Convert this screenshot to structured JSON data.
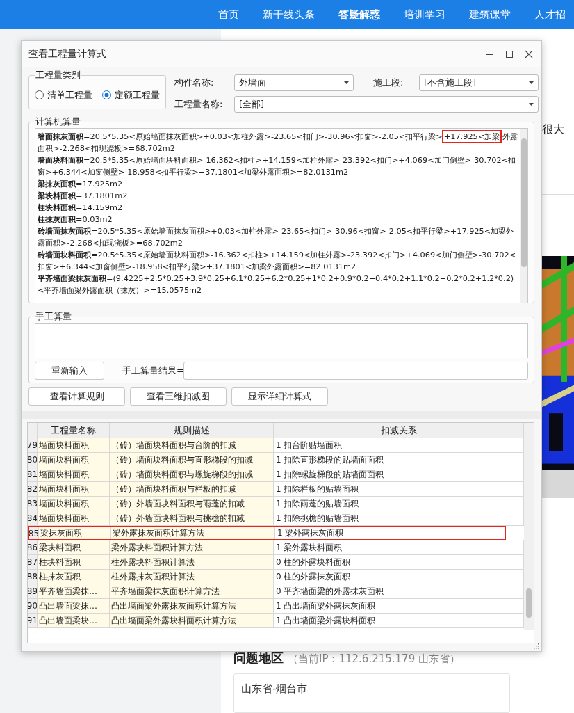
{
  "nav": {
    "items": [
      {
        "label": "首页",
        "selected": false
      },
      {
        "label": "新干线头条",
        "selected": false
      },
      {
        "label": "答疑解惑",
        "selected": true
      },
      {
        "label": "培训学习",
        "selected": false
      },
      {
        "label": "建筑课堂",
        "selected": false
      },
      {
        "label": "人才招",
        "selected": false
      }
    ]
  },
  "page": {
    "snippet": "很大",
    "region": {
      "title": "问题地区",
      "ip_note": "（当前IP：112.6.215.179 山东省）",
      "value": "山东省-烟台市"
    }
  },
  "dialog": {
    "title": "查看工程量计算式",
    "quantity_type": {
      "legend": "工程量类别",
      "options": [
        {
          "label": "清单工程量",
          "selected": false
        },
        {
          "label": "定额工程量",
          "selected": true
        }
      ]
    },
    "component": {
      "label": "构件名称:",
      "value": "外墙面"
    },
    "stage": {
      "label": "施工段:",
      "value": "[不含施工段]"
    },
    "quantity_name": {
      "label": "工程量名称:",
      "value": "[全部]"
    },
    "computer": {
      "legend": "计算机算量",
      "formulas": [
        {
          "name": "墙面抹灰面积",
          "parts": [
            {
              "text": "=20.5*5.35<原始墙面抹灰面积>+0.03<加柱外露>-23.65<扣门>-30.96<扣窗>-2.05<扣平行梁>",
              "highlighted": false
            },
            {
              "text": "+17.925<加梁",
              "highlighted": true
            },
            {
              "text": "外露面积>-2.268<扣现浇板>=68.702m2",
              "highlighted": false
            }
          ]
        },
        {
          "name": "墙面块料面积",
          "parts": [
            {
              "text": "=20.5*5.35<原始墙面块料面积>-16.362<扣柱>+14.159<加柱外露>-23.392<扣门>+4.069<加门侧壁>-30.702<扣窗>+6.344<加窗侧壁>-18.958<扣平行梁>+37.1801<加梁外露面积>=82.0131m2",
              "highlighted": false
            }
          ]
        },
        {
          "name": "梁抹灰面积",
          "parts": [
            {
              "text": "=17.925m2",
              "highlighted": false
            }
          ]
        },
        {
          "name": "梁块料面积",
          "parts": [
            {
              "text": "=37.1801m2",
              "highlighted": false
            }
          ]
        },
        {
          "name": "柱块料面积",
          "parts": [
            {
              "text": "=14.159m2",
              "highlighted": false
            }
          ]
        },
        {
          "name": "柱抹灰面积",
          "parts": [
            {
              "text": "=0.03m2",
              "highlighted": false
            }
          ]
        },
        {
          "name": "砖墙面抹灰面积",
          "parts": [
            {
              "text": "=20.5*5.35<原始墙面抹灰面积>+0.03<加柱外露>-23.65<扣门>-30.96<扣窗>-2.05<扣平行梁>+17.925<加梁外露面积>-2.268<扣现浇板>=68.702m2",
              "highlighted": false
            }
          ]
        },
        {
          "name": "砖墙面块料面积",
          "parts": [
            {
              "text": "=20.5*5.35<原始墙面块料面积>-16.362<扣柱>+14.159<加柱外露>-23.392<扣门>+4.069<加门侧壁>-30.702<扣窗>+6.344<加窗侧壁>-18.958<扣平行梁>+37.1801<加梁外露面积>=82.0131m2",
              "highlighted": false
            }
          ]
        },
        {
          "name": "平齐墙面梁抹灰面积",
          "parts": [
            {
              "text": "=(9.4225+2.5*0.25+3.9*0.25+6.1*0.25+6.2*0.25+1*0.2+0.9*0.2+0.4*0.2+1.1*0.2+0.2*0.2+1.2*0.2)<平齐墙面梁外露面积（抹灰）>=15.0575m2",
              "highlighted": false
            }
          ]
        }
      ]
    },
    "manual": {
      "legend": "手工算量",
      "reset_button": "重新输入",
      "result_label": "手工算量结果="
    },
    "buttons": [
      "查看计算规则",
      "查看三维扣减图",
      "显示详细计算式"
    ],
    "table": {
      "columns": [
        "工程量名称",
        "规则描述",
        "扣减关系"
      ],
      "rows": [
        {
          "no": "79",
          "name": "墙面块料面积",
          "description": "（砖）墙面块料面积与台阶的扣减",
          "relation": "1 扣台阶贴墙面积",
          "highlighted": false
        },
        {
          "no": "80",
          "name": "墙面块料面积",
          "description": "（砖）墙面块料面积与直形梯段的扣减",
          "relation": "1 扣除直形梯段的贴墙面面积",
          "highlighted": false
        },
        {
          "no": "81",
          "name": "墙面块料面积",
          "description": "（砖）墙面块料面积与螺旋梯段的扣减",
          "relation": "1 扣除螺旋梯段的贴墙面面积",
          "highlighted": false
        },
        {
          "no": "82",
          "name": "墙面块料面积",
          "description": "（砖）墙面块料面积与栏板的扣减",
          "relation": "1 扣除栏板的贴墙面积",
          "highlighted": false
        },
        {
          "no": "83",
          "name": "墙面块料面积",
          "description": "（砖）外墙面块料面积与雨蓬的扣减",
          "relation": "1 扣除雨蓬的贴墙面积",
          "highlighted": false
        },
        {
          "no": "84",
          "name": "墙面块料面积",
          "description": "（砖）外墙面块料面积与挑檐的扣减",
          "relation": "1 扣除挑檐的贴墙面积",
          "highlighted": false
        },
        {
          "no": "85",
          "name": "梁抹灰面积",
          "description": "梁外露抹灰面积计算方法",
          "relation": "1 梁外露抹灰面积",
          "highlighted": true
        },
        {
          "no": "86",
          "name": "梁块料面积",
          "description": "梁外露块料面积计算方法",
          "relation": "1 梁外露块料面积",
          "highlighted": false
        },
        {
          "no": "87",
          "name": "柱块料面积",
          "description": "柱外露块料面积计算法",
          "relation": "0 柱的外露块料面积",
          "highlighted": false
        },
        {
          "no": "88",
          "name": "柱抹灰面积",
          "description": "柱外露抹灰面积计算法",
          "relation": "0 柱的外露抹灰面积",
          "highlighted": false
        },
        {
          "no": "89",
          "name": "平齐墙面梁抹…",
          "description": "平齐墙面梁抹灰面积计算方法",
          "relation": "0 平齐墙面梁的外露抹灰面积",
          "highlighted": false
        },
        {
          "no": "90",
          "name": "凸出墙面梁抹…",
          "description": "凸出墙面梁外露抹灰面积计算方法",
          "relation": "1 凸出墙面梁外露抹灰面积",
          "highlighted": false
        },
        {
          "no": "91",
          "name": "凸出墙面梁块…",
          "description": "凸出墙面梁外露块料面积计算方法",
          "relation": "1 凸出墙面梁外露块料面积",
          "highlighted": false
        }
      ]
    }
  }
}
